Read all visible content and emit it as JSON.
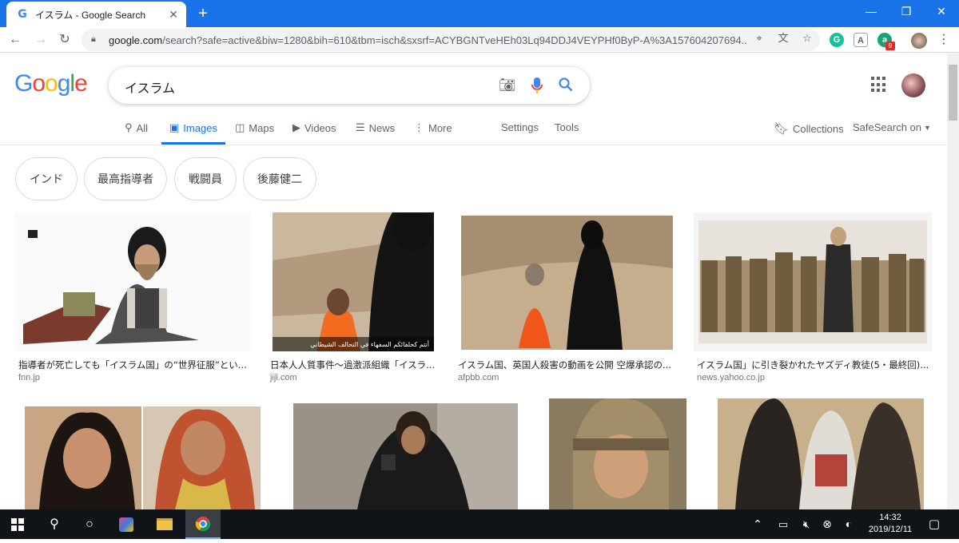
{
  "browser": {
    "tab_title": "イスラム - Google Search",
    "url_host": "google.com",
    "url_path": "/search?safe=active&biw=1280&bih=610&tbm=isch&sxsrf=ACYBGNTveHEh03Lq94DDJ4VEYPHf0ByP-A%3A157604207694...",
    "ext_badge": "9"
  },
  "search": {
    "query": "イスラム",
    "logo": [
      "G",
      "o",
      "o",
      "g",
      "l",
      "e"
    ],
    "logo_colors": [
      "#4285f4",
      "#ea4335",
      "#fbbc05",
      "#4285f4",
      "#34a853",
      "#ea4335"
    ]
  },
  "nav": {
    "all": "All",
    "images": "Images",
    "maps": "Maps",
    "videos": "Videos",
    "news": "News",
    "more": "More",
    "settings": "Settings",
    "tools": "Tools",
    "collections": "Collections",
    "safesearch": "SafeSearch on"
  },
  "chips": [
    "インド",
    "最高指導者",
    "戦闘員",
    "後藤健二"
  ],
  "results": [
    {
      "title": "指導者が死亡しても「イスラム国」の“世界征服”とい...",
      "source": "fnn.jp"
    },
    {
      "title": "日本人人質事件～過激派組織「イスラ...",
      "source": "jiji.com"
    },
    {
      "title": "イスラム国、英国人殺害の動画を公開 空爆承認の...",
      "source": "afpbb.com"
    },
    {
      "title": "イスラム国」に引き裂かれたヤズディ教徒(5・最終回)...",
      "source": "news.yahoo.co.jp"
    }
  ],
  "image_caption": "أنتم كحلفائكم السفهاء في التحالف الشيطاني",
  "taskbar": {
    "time": "14:32",
    "date": "2019/12/11"
  }
}
